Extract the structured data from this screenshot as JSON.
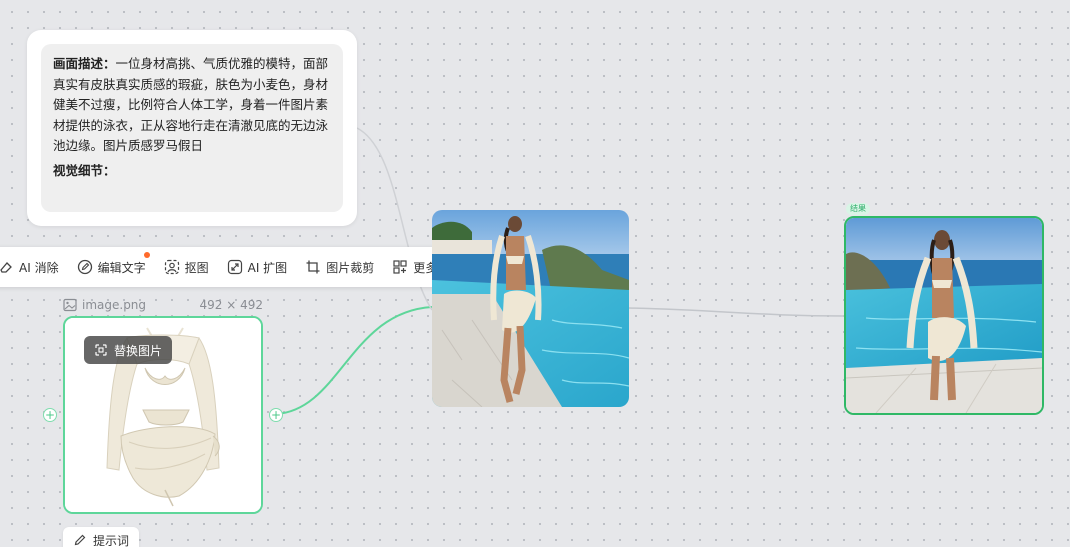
{
  "description_card": {
    "label": "画面描述：",
    "text": "一位身材高挑、气质优雅的模特，面部真实有皮肤真实质感的瑕疵，肤色为小麦色，身材健美不过瘦，比例符合人体工学，身着一件图片素材提供的泳衣，正从容地行走在清澈见底的无边泳池边缘。图片质感罗马假日",
    "detail_label": "视觉细节："
  },
  "toolbar": {
    "items": [
      {
        "icon": "eraser-icon",
        "label": "AI 消除"
      },
      {
        "icon": "edit-text-icon",
        "label": "编辑文字"
      },
      {
        "icon": "cutout-icon",
        "label": "抠图"
      },
      {
        "icon": "expand-icon",
        "label": "AI 扩图"
      },
      {
        "icon": "crop-icon",
        "label": "图片裁剪"
      },
      {
        "icon": "more-grid-icon",
        "label": "更多"
      }
    ]
  },
  "source_image": {
    "filename": "image.png",
    "dimensions": "492 × 492",
    "replace_label": "替换图片"
  },
  "prompt_chip": {
    "label": "提示词"
  },
  "result_node": {
    "tag": "结果"
  },
  "colors": {
    "accent_green": "#2fb866",
    "connector_green": "#5ed69a",
    "badge_orange": "#ff6a2b",
    "canvas_bg": "#e6e7ea"
  }
}
